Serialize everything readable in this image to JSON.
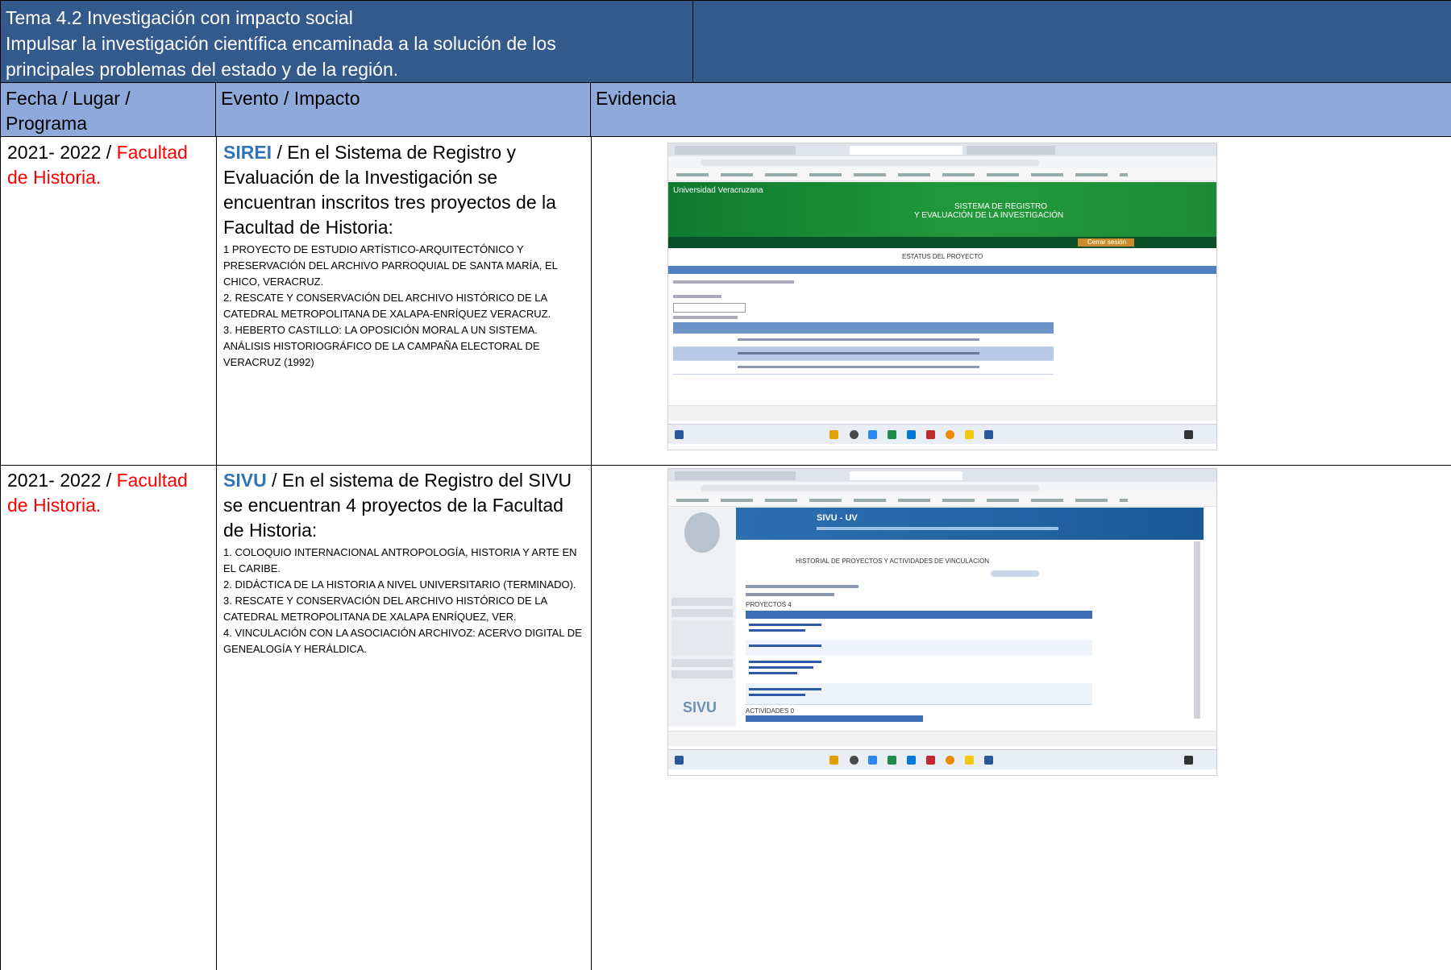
{
  "header": {
    "line1": "Tema 4.2 Investigación con impacto social",
    "line2": "Impulsar la investigación científica encaminada a la solución de los",
    "line3": "principales problemas del estado y de la región."
  },
  "columns": {
    "col1_line1": "Fecha / Lugar /",
    "col1_line2": "Programa",
    "col2": "Evento / Impacto",
    "col3": "Evidencia"
  },
  "rows": [
    {
      "date": "2021- 2022 / ",
      "place_part1": "Facultad",
      "place_part2": "de Historia.",
      "tag": "SIREI",
      "lead": " / En el Sistema de Registro y Evaluación de la Investigación se encuentran inscritos tres proyectos de la Facultad de Historia:",
      "items": [
        "1 PROYECTO DE ESTUDIO ARTÍSTICO-ARQUITECTÓNICO Y PRESERVACIÓN DEL ARCHIVO PARROQUIAL DE SANTA MARÍA, EL CHICO, VERACRUZ.",
        "2. RESCATE Y CONSERVACIÓN DEL ARCHIVO HISTÓRICO DE LA CATEDRAL METROPOLITANA DE XALAPA-ENRÍQUEZ VERACRUZ.",
        "3. HEBERTO CASTILLO: LA OPOSICIÓN MORAL A UN SISTEMA. ANÁLISIS HISTORIOGRÁFICO DE LA CAMPAÑA ELECTORAL DE VERACRUZ (1992)"
      ],
      "evidence": {
        "site_name": "Universidad Veracruzana",
        "banner_line1": "SISTEMA DE REGISTRO",
        "banner_line2": "Y EVALUACIÓN DE LA INVESTIGACIÓN",
        "page_heading": "ESTATUS DEL PROYECTO",
        "logout": "Cerrar sesión"
      }
    },
    {
      "date": "2021- 2022 / ",
      "place_part1": "Facultad",
      "place_part2": "de Historia.",
      "tag": "SIVU",
      "lead": " / En el sistema de Registro del SIVU se encuentran 4 proyectos de la Facultad de Historia:",
      "items": [
        "1. COLOQUIO INTERNACIONAL ANTROPOLOGÍA, HISTORIA Y ARTE EN EL CARIBE.",
        "2. DIDÁCTICA DE LA HISTORIA A NIVEL UNIVERSITARIO (TERMINADO).",
        "3. RESCATE Y CONSERVACIÓN DEL ARCHIVO HISTÓRICO DE LA CATEDRAL METROPOLITANA DE XALAPA ENRÍQUEZ, VER.",
        "4. VINCULACIÓN CON LA ASOCIACIÓN ARCHIVOZ: ACERVO DIGITAL DE GENEALOGÍA Y HERÁLDICA."
      ],
      "evidence": {
        "banner_title": "SIVU - UV",
        "page_heading": "HISTORIAL DE PROYECTOS Y ACTIVIDADES DE VINCULACION",
        "projects_label": "PROYECTOS 4",
        "activities_label": "ACTIVIDADES 0",
        "logo_text": "SIVU"
      }
    }
  ],
  "colors": {
    "header_bg": "#335a8a",
    "column_header_bg": "#8eaadb",
    "place_text": "#ff0000",
    "tag_text": "#2f75b5"
  }
}
